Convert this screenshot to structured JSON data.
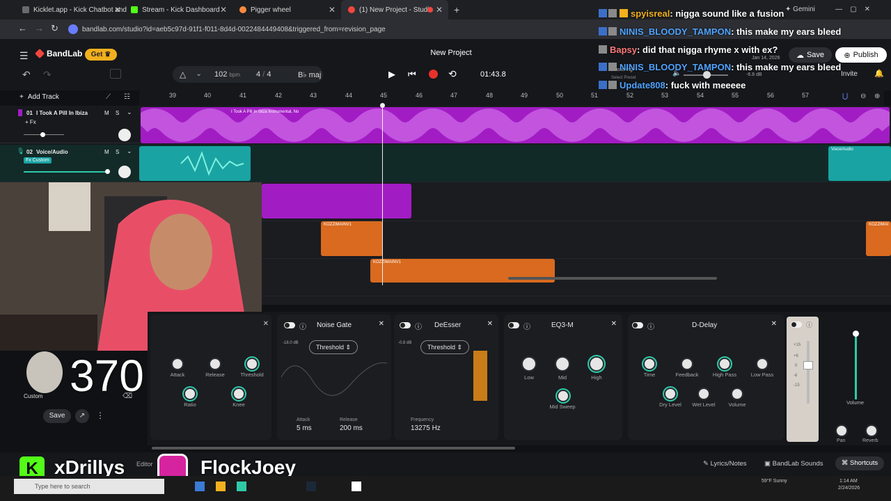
{
  "browser": {
    "tabs": [
      {
        "title": "Kicklet.app - Kick Chatbot and",
        "color": "#6a6a6a"
      },
      {
        "title": "Stream - Kick Dashboard",
        "color": "#53fc18"
      },
      {
        "title": "Pigger wheel",
        "color": "#ff8a3d"
      },
      {
        "title": "(1) New Project - Studio",
        "color": "#f2453d"
      }
    ],
    "url": "bandlab.com/studio?id=aeb5c97d-91f1-f011-8d4d-0022484449408&triggered_from=revision_page",
    "gemini_label": "Gemini"
  },
  "header": {
    "brand": "BandLab",
    "get_label": "Get",
    "project_title": "New Project",
    "save_label": "Save",
    "publish_label": "Publish",
    "invite_label": "Invite",
    "mastering_label": "Mastering",
    "preset_label": "Select Preset",
    "volume_db": "-6.8 dB",
    "date_label": "Jan 14, 2026"
  },
  "transport": {
    "bpm": "102",
    "bpm_unit": "bpm",
    "time_sig_num": "4",
    "time_sig_den": "4",
    "key": "B♭ maj",
    "time": "01:43.8"
  },
  "chat": [
    {
      "user": "spyisreal",
      "user_color": "#f2b01e",
      "message": ": nigga sound like a fusion"
    },
    {
      "user": "NINIS_BLOODY_TAMPON",
      "user_color": "#4fa3ff",
      "message": ": this make my ears bleed"
    },
    {
      "user": "Bapsy",
      "user_color": "#ff7a7a",
      "message": ": did that nigga rhyme x with ex?"
    },
    {
      "user": "NINIS_BLOODY_TAMPON",
      "user_color": "#4fa3ff",
      "message": ": this make my ears bleed"
    },
    {
      "user": "Update808",
      "user_color": "#4fa3ff",
      "message": ": fuck with meeeee"
    }
  ],
  "timeline": {
    "add_track_label": "Add Track",
    "ruler": [
      "39",
      "40",
      "41",
      "42",
      "43",
      "44",
      "45",
      "46",
      "47",
      "48",
      "49",
      "50",
      "51",
      "52",
      "53",
      "54",
      "55",
      "56",
      "57"
    ],
    "tracks": [
      {
        "num": "01",
        "name": "I Took A Pill In Ibiza",
        "fx": "+ Fx",
        "m": "M",
        "s": "S",
        "region_label": "I Took A Pill In Ibiza Instrumental, No"
      },
      {
        "num": "02",
        "name": "Voice/Audio",
        "fx": "Fx Custom",
        "m": "M",
        "s": "S",
        "region_label": "Voice/Audio"
      }
    ],
    "extra_regions": [
      "KOZZIMAINV1",
      "KOZZIMAINV1",
      "KOZZIMAI"
    ]
  },
  "fx": {
    "compressor": {
      "knobs": [
        "Attack",
        "Release",
        "Threshold",
        "Ratio",
        "Knee"
      ],
      "save_label": "Save",
      "custom_label": "Custom"
    },
    "noise_gate": {
      "title": "Noise Gate",
      "db": "-18.0 dB",
      "param": "Threshold",
      "attack_label": "Attack",
      "attack": "5 ms",
      "release_label": "Release",
      "release": "200 ms"
    },
    "deesser": {
      "title": "DeEsser",
      "db": "-0.8 dB",
      "param": "Threshold",
      "freq_label": "Frequency",
      "freq": "13275 Hz"
    },
    "eq": {
      "title": "EQ3-M",
      "knobs": [
        "Low",
        "Mid",
        "High",
        "Mid Sweep"
      ]
    },
    "delay": {
      "title": "D-Delay",
      "knobs": [
        "Time",
        "Feedback",
        "High Pass",
        "Low Pass",
        "Dry Level",
        "Wet Level",
        "Volume"
      ]
    },
    "meter": {
      "labels": [
        "+15",
        "+6",
        "0",
        "-6",
        "-15"
      ]
    },
    "master": {
      "volume_label": "Volume",
      "pan_label": "Pan",
      "reverb_label": "Reverb"
    }
  },
  "bottom": {
    "editor_label": "Editor",
    "lyrics_label": "Lyrics/Notes",
    "sounds_label": "BandLab Sounds",
    "shortcuts_label": "Shortcuts"
  },
  "overlay": {
    "counter": "370",
    "kick_name": "xDrillys",
    "ig_name": "FlockJoey"
  },
  "taskbar": {
    "search_placeholder": "Type here to search",
    "weather": "59°F Sunny",
    "time": "1:14 AM",
    "date": "2/24/2026"
  }
}
